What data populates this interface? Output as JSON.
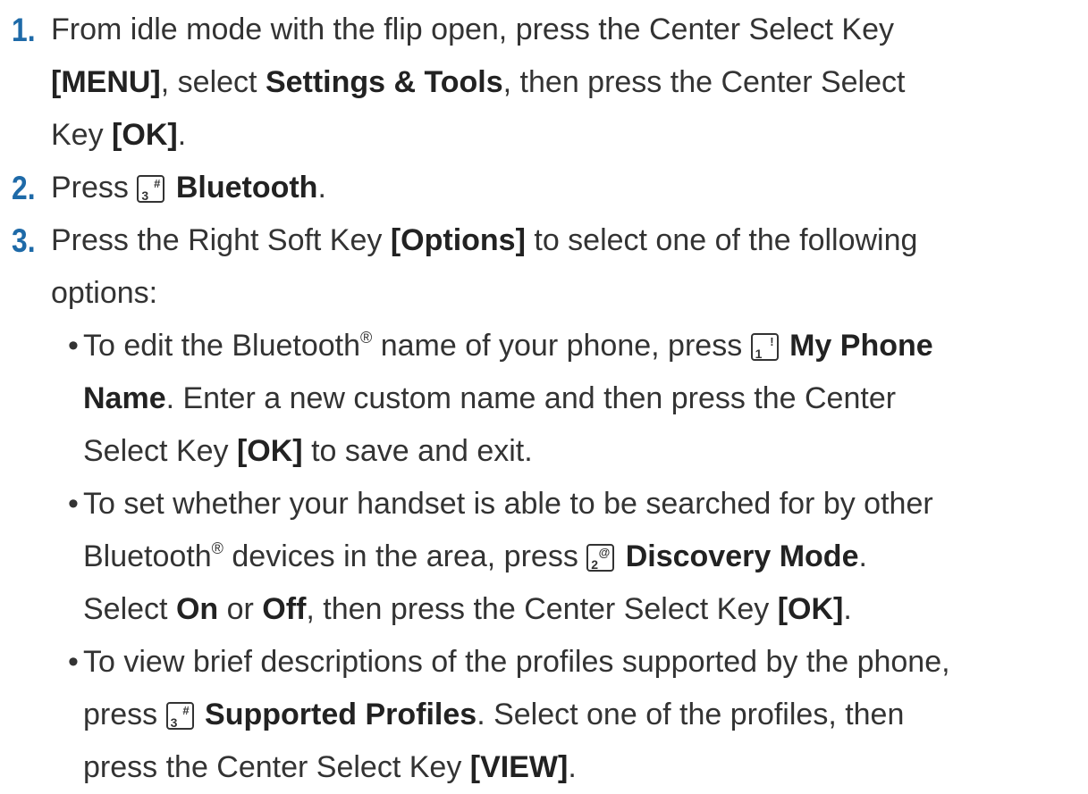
{
  "steps": [
    {
      "number": "1.",
      "lines": [
        [
          "From idle mode with the flip open, press the Center Select Key"
        ],
        [
          "[MENU]",
          ", select ",
          "Settings & Tools",
          ", then press the Center Select"
        ],
        [
          "Key ",
          "[OK]",
          "."
        ]
      ]
    },
    {
      "number": "2.",
      "pre": "Press ",
      "key": {
        "num": "3",
        "sym": "#"
      },
      "bold": "Bluetooth",
      "post": "."
    },
    {
      "number": "3.",
      "line1_pre": "Press the Right Soft Key ",
      "line1_bold": "[Options]",
      "line1_post": " to select one of the following",
      "line2": "options:"
    }
  ],
  "bullets": [
    {
      "l1_pre": "To edit the Bluetooth",
      "l1_reg": "®",
      "l1_mid": " name of your phone, press ",
      "key": {
        "num": "1",
        "sym": "!"
      },
      "l1_bold": "My Phone",
      "l2_bold": "Name",
      "l2_post": ". Enter a new custom name and then press the Center",
      "l3_pre": "Select Key ",
      "l3_bold": "[OK]",
      "l3_post": " to save and exit."
    },
    {
      "l1": "To set whether your handset is able to be searched for by other",
      "l2_pre": "Bluetooth",
      "l2_reg": "®",
      "l2_mid": " devices in the area, press ",
      "key": {
        "num": "2",
        "sym": "@"
      },
      "l2_bold": "Discovery Mode",
      "l2_post": ".",
      "l3_pre": "Select ",
      "l3_on": "On",
      "l3_or": " or ",
      "l3_off": "Off",
      "l3_mid": ", then press the Center Select Key ",
      "l3_bold": "[OK]",
      "l3_post": "."
    },
    {
      "l1": "To view brief descriptions of the profiles supported by the phone,",
      "l2_pre": "press ",
      "key": {
        "num": "3",
        "sym": "#"
      },
      "l2_bold": "Supported Profiles",
      "l2_post": ". Select one of the profiles, then",
      "l3_pre": "press the Center Select Key ",
      "l3_bold": "[VIEW]",
      "l3_post": "."
    }
  ]
}
